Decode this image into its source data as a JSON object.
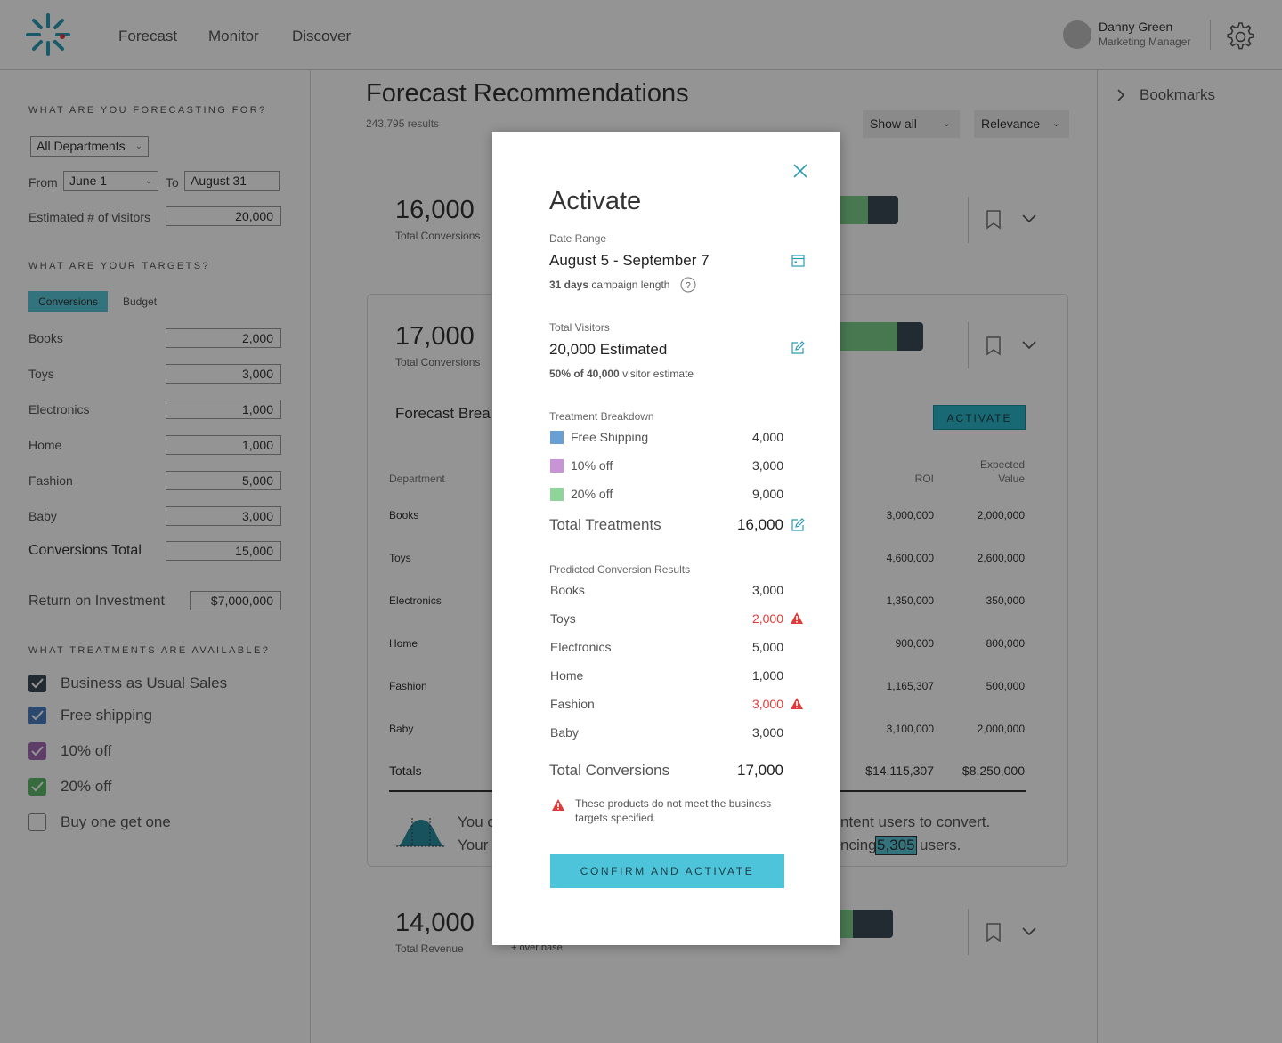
{
  "header": {
    "nav": [
      "Forecast",
      "Monitor",
      "Discover"
    ],
    "user": {
      "name": "Danny Green",
      "role": "Marketing Manager"
    }
  },
  "sidebar": {
    "forecasting_title": "WHAT ARE YOU FORECASTING FOR?",
    "department": "All Departments",
    "from_label": "From",
    "from_value": "June 1",
    "to_label": "To",
    "to_value": "August 31",
    "visitors_label": "Estimated # of visitors",
    "visitors_value": "20,000",
    "targets_title": "WHAT ARE YOUR TARGETS?",
    "tabs": [
      "Conversions",
      "Budget"
    ],
    "targets": [
      {
        "label": "Books",
        "value": "2,000"
      },
      {
        "label": "Toys",
        "value": "3,000"
      },
      {
        "label": "Electronics",
        "value": "1,000"
      },
      {
        "label": "Home",
        "value": "1,000"
      },
      {
        "label": "Fashion",
        "value": "5,000"
      },
      {
        "label": "Baby",
        "value": "3,000"
      }
    ],
    "conversions_total_label": "Conversions Total",
    "conversions_total_value": "15,000",
    "roi_label": "Return on Investment",
    "roi_value": "$7,000,000",
    "treatments_title": "WHAT TREATMENTS ARE AVAILABLE?",
    "treatments": [
      {
        "label": "Business as Usual Sales",
        "checked": true,
        "color": "#3d4a57"
      },
      {
        "label": "Free shipping",
        "checked": true,
        "color": "#4a7fc0"
      },
      {
        "label": "10% off",
        "checked": true,
        "color": "#a36ab5"
      },
      {
        "label": "20% off",
        "checked": true,
        "color": "#5cb86a"
      },
      {
        "label": "Buy one get one",
        "checked": false,
        "color": "#999999"
      }
    ]
  },
  "main": {
    "title": "Forecast Recommendations",
    "results": "243,795 results",
    "show_all": "Show all",
    "relevance": "Relevance",
    "cards": [
      {
        "value": "16,000",
        "label": "Total Conversions"
      },
      {
        "value": "17,000",
        "label": "Total Conversions"
      },
      {
        "value": "14,000",
        "label": "Total Revenue"
      }
    ],
    "card3_sub": "+ over base",
    "breakdown_title": "Forecast Brea",
    "activate": "ACTIVATE",
    "table": {
      "dept_header": "Department",
      "roi_header": "ROI",
      "ev_header_1": "Expected",
      "ev_header_2": "Value",
      "rows": [
        {
          "dept": "Books",
          "roi": "3,000,000",
          "ev": "2,000,000"
        },
        {
          "dept": "Toys",
          "roi": "4,600,000",
          "ev": "2,600,000"
        },
        {
          "dept": "Electronics",
          "roi": "1,350,000",
          "ev": "350,000"
        },
        {
          "dept": "Home",
          "roi": "900,000",
          "ev": "800,000"
        },
        {
          "dept": "Fashion",
          "roi": "1,165,307",
          "ev": "500,000"
        },
        {
          "dept": "Baby",
          "roi": "3,100,000",
          "ev": "2,000,000"
        }
      ],
      "totals_label": "Totals",
      "totals_roi": "$14,115,307",
      "totals_ev": "$8,250,000"
    },
    "insight_left_1": "You c",
    "insight_left_2": "Your",
    "insight_right_1": "ntent users to convert.",
    "insight_right_2_pre": "ncing",
    "insight_highlight": "5,305",
    "insight_right_2_post": "users."
  },
  "bookmarks": "Bookmarks",
  "modal": {
    "title": "Activate",
    "date_range_caption": "Date Range",
    "date_range": "August 5 - September 7",
    "campaign_days": "31 days",
    "campaign_text": "campaign length",
    "visitors_caption": "Total Visitors",
    "visitors_value": "20,000 Estimated",
    "visitors_pct": "50% of 40,000",
    "visitors_text": "visitor estimate",
    "treatment_caption": "Treatment Breakdown",
    "treatments": [
      {
        "label": "Free Shipping",
        "value": "4,000",
        "color": "#6a9fd4"
      },
      {
        "label": "10% off",
        "value": "3,000",
        "color": "#c795d6"
      },
      {
        "label": "20% off",
        "value": "9,000",
        "color": "#8fd49a"
      }
    ],
    "total_treatments_label": "Total Treatments",
    "total_treatments_value": "16,000",
    "predicted_caption": "Predicted Conversion Results",
    "predicted": [
      {
        "label": "Books",
        "value": "3,000",
        "warn": false
      },
      {
        "label": "Toys",
        "value": "2,000",
        "warn": true
      },
      {
        "label": "Electronics",
        "value": "5,000",
        "warn": false
      },
      {
        "label": "Home",
        "value": "1,000",
        "warn": false
      },
      {
        "label": "Fashion",
        "value": "3,000",
        "warn": true
      },
      {
        "label": "Baby",
        "value": "3,000",
        "warn": false
      }
    ],
    "total_conversions_label": "Total Conversions",
    "total_conversions_value": "17,000",
    "warning_note": "These products do not meet the business targets specified.",
    "confirm": "CONFIRM AND ACTIVATE"
  }
}
